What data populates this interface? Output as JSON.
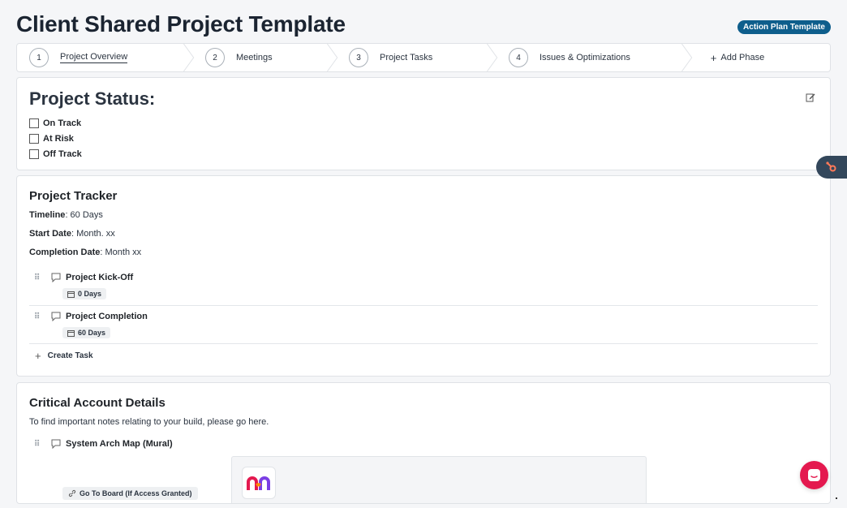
{
  "page": {
    "title": "Client Shared Project Template",
    "badge": "Action Plan Template"
  },
  "phases": [
    {
      "number": "1",
      "label": "Project Overview",
      "active": true
    },
    {
      "number": "2",
      "label": "Meetings"
    },
    {
      "number": "3",
      "label": "Project Tasks"
    },
    {
      "number": "4",
      "label": "Issues & Optimizations"
    }
  ],
  "add_phase_label": "Add Phase",
  "status_card": {
    "title": "Project Status:",
    "options": [
      "On Track",
      "At Risk",
      "Off Track"
    ],
    "edit_icon": "edit-icon"
  },
  "tracker": {
    "title": "Project Tracker",
    "timeline_label": "Timeline",
    "timeline_value": ": 60 Days",
    "start_label": "Start Date",
    "start_value": ": Month. xx",
    "completion_label": "Completion Date",
    "completion_value": ": Month xx",
    "tasks": [
      {
        "title": "Project Kick-Off",
        "duration": "0 Days"
      },
      {
        "title": "Project Completion",
        "duration": "60 Days"
      }
    ],
    "create_task_label": "Create Task"
  },
  "details": {
    "title": "Critical Account Details",
    "description": "To find important notes relating to your build, please go here.",
    "task_title": "System Arch Map (Mural)",
    "link_label": "Go To Board (If Access Granted)"
  },
  "colors": {
    "badge": "#0e5e8c",
    "hubspot": "#33475b",
    "hubspot_accent": "#ff7a59",
    "chat_bubble": "#e4194f"
  }
}
